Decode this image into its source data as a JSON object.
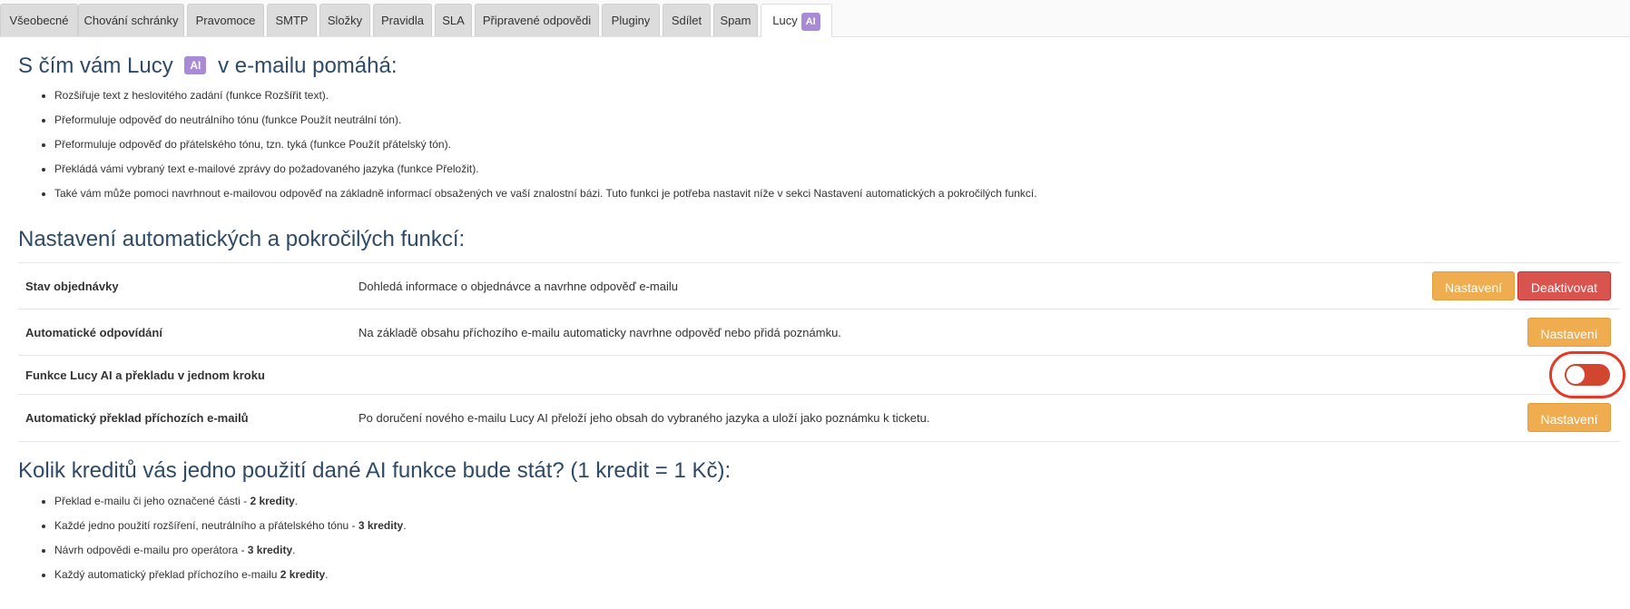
{
  "tabs": [
    {
      "label": "Všeobecné"
    },
    {
      "label": "Chování schránky"
    },
    {
      "label": "Pravomoce"
    },
    {
      "label": "SMTP"
    },
    {
      "label": "Složky"
    },
    {
      "label": "Pravidla"
    },
    {
      "label": "SLA"
    },
    {
      "label": "Připravené odpovědi"
    },
    {
      "label": "Pluginy"
    },
    {
      "label": "Sdílet"
    },
    {
      "label": "Spam"
    },
    {
      "label": "Lucy",
      "badge": "AI"
    }
  ],
  "help": {
    "title_pre": "S čím vám Lucy",
    "badge": "AI",
    "title_post": "v e-mailu pomáhá:",
    "items": [
      "Rozšiřuje text z heslovitého zadání (funkce Rozšířit text).",
      "Přeformuluje odpověď do neutrálního tónu (funkce Použít neutrální tón).",
      "Přeformuluje odpověď do přátelského tónu, tzn. tyká (funkce Použít přátelský tón).",
      "Překládá vámi vybraný text e-mailové zprávy do požadovaného jazyka (funkce Přeložit).",
      "Také vám může pomoci navrhnout e-mailovou odpověď na základně informací obsažených ve vaší znalostní bázi. Tuto funkci je potřeba nastavit níže v sekci Nastavení automatických a pokročilých funkcí."
    ]
  },
  "settings": {
    "title": "Nastavení automatických a pokročilých funkcí:",
    "rows": [
      {
        "label": "Stav objednávky",
        "description": "Dohledá informace o objednávce a navrhne odpověď e-mailu",
        "settings_button": "Nastavení",
        "deactivate_button": "Deaktivovat"
      },
      {
        "label": "Automatické odpovídání",
        "description": "Na základě obsahu příchozího e-mailu automaticky navrhne odpověď nebo přidá poznámku.",
        "settings_button": "Nastavení"
      },
      {
        "label": "Funkce Lucy AI a překladu v jednom kroku",
        "toggle_on": false
      },
      {
        "label": "Automatický překlad příchozích e-mailů",
        "description": "Po doručení nového e-mailu Lucy AI přeloží jeho obsah do vybraného jazyka a uloží jako poznámku k ticketu.",
        "settings_button": "Nastavení"
      }
    ]
  },
  "credits": {
    "title": "Kolik kreditů vás jedno použití dané AI funkce bude stát? (1 kredit = 1 Kč):",
    "items": [
      {
        "text": "Překlad e-mailu či jeho označené části - ",
        "bold": "2 kredity",
        "suffix": "."
      },
      {
        "text": "Každé jedno použití rozšíření, neutrálního a přátelského tónu - ",
        "bold": "3 kredity",
        "suffix": "."
      },
      {
        "text": "Návrh odpovědi e-mailu pro operátora - ",
        "bold": "3 kredity",
        "suffix": "."
      },
      {
        "text": "Každý automatický překlad příchozího e-mailu ",
        "bold": "2 kredity",
        "suffix": "."
      }
    ]
  },
  "colors": {
    "ai_badge": "#a98ad6",
    "warning_button": "#efad4f",
    "danger_button": "#d9534f",
    "heading": "#2f4a66",
    "highlight_ring": "#e23a26"
  }
}
